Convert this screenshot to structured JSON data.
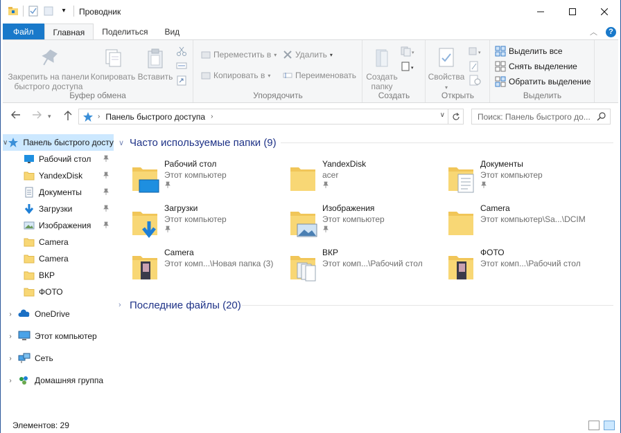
{
  "window": {
    "title": "Проводник"
  },
  "ribbon_tabs": {
    "file": "Файл",
    "home": "Главная",
    "share": "Поделиться",
    "view": "Вид"
  },
  "ribbon": {
    "clipboard": {
      "label": "Буфер обмена",
      "pin": "Закрепить на панели быстрого доступа",
      "pin_line1": "Закрепить на панели",
      "pin_line2": "быстрого доступа",
      "copy": "Копировать",
      "paste": "Вставить"
    },
    "organize": {
      "label": "Упорядочить",
      "move_to": "Переместить в",
      "copy_to": "Копировать в",
      "delete": "Удалить",
      "rename": "Переименовать"
    },
    "create": {
      "label": "Создать",
      "new_folder_line1": "Создать",
      "new_folder_line2": "папку"
    },
    "open": {
      "label": "Открыть",
      "properties": "Свойства"
    },
    "select": {
      "label": "Выделить",
      "select_all": "Выделить все",
      "select_none": "Снять выделение",
      "invert": "Обратить выделение"
    }
  },
  "address": {
    "path": "Панель быстрого доступа"
  },
  "search": {
    "placeholder": "Поиск: Панель быстрого до..."
  },
  "nav": {
    "quick_access": "Панель быстрого доступа",
    "items": [
      {
        "label": "Рабочий стол",
        "icon": "desktop-icon",
        "pinned": true
      },
      {
        "label": "YandexDisk",
        "icon": "folder-icon",
        "pinned": true
      },
      {
        "label": "Документы",
        "icon": "documents-icon",
        "pinned": true
      },
      {
        "label": "Загрузки",
        "icon": "downloads-icon",
        "pinned": true
      },
      {
        "label": "Изображения",
        "icon": "pictures-icon",
        "pinned": true
      },
      {
        "label": "Camera",
        "icon": "folder-icon",
        "pinned": false
      },
      {
        "label": "Camera",
        "icon": "folder-icon",
        "pinned": false
      },
      {
        "label": "ВКР",
        "icon": "folder-icon",
        "pinned": false
      },
      {
        "label": "ФОТО",
        "icon": "folder-icon",
        "pinned": false
      }
    ],
    "roots": [
      {
        "label": "OneDrive",
        "icon": "onedrive-icon"
      },
      {
        "label": "Этот компьютер",
        "icon": "computer-icon"
      },
      {
        "label": "Сеть",
        "icon": "network-icon"
      },
      {
        "label": "Домашняя группа",
        "icon": "homegroup-icon"
      }
    ]
  },
  "content": {
    "frequent_header": "Часто используемые папки (9)",
    "recent_header": "Последние файлы (20)",
    "folders": [
      {
        "name": "Рабочий стол",
        "sub": "Этот компьютер",
        "pinned": true,
        "icon": "desktop-folder-icon"
      },
      {
        "name": "YandexDisk",
        "sub": "acer",
        "pinned": true,
        "icon": "folder-icon"
      },
      {
        "name": "Документы",
        "sub": "Этот компьютер",
        "pinned": true,
        "icon": "documents-folder-icon"
      },
      {
        "name": "Загрузки",
        "sub": "Этот компьютер",
        "pinned": true,
        "icon": "downloads-folder-icon"
      },
      {
        "name": "Изображения",
        "sub": "Этот компьютер",
        "pinned": true,
        "icon": "pictures-folder-icon"
      },
      {
        "name": "Camera",
        "sub": "Этот компьютер\\Sa...\\DCIM",
        "pinned": false,
        "icon": "folder-icon"
      },
      {
        "name": "Camera",
        "sub": "Этот комп...\\Новая папка (3)",
        "pinned": false,
        "icon": "photo-folder-icon"
      },
      {
        "name": "ВКР",
        "sub": "Этот комп...\\Рабочий стол",
        "pinned": false,
        "icon": "docs-stack-folder-icon"
      },
      {
        "name": "ФОТО",
        "sub": "Этот комп...\\Рабочий стол",
        "pinned": false,
        "icon": "photo-folder-icon"
      }
    ]
  },
  "status": {
    "items_count": "Элементов: 29"
  },
  "colors": {
    "accent": "#1979ca",
    "selection": "#cce8ff",
    "folder": "#f8d775",
    "header_text": "#1e3287"
  }
}
